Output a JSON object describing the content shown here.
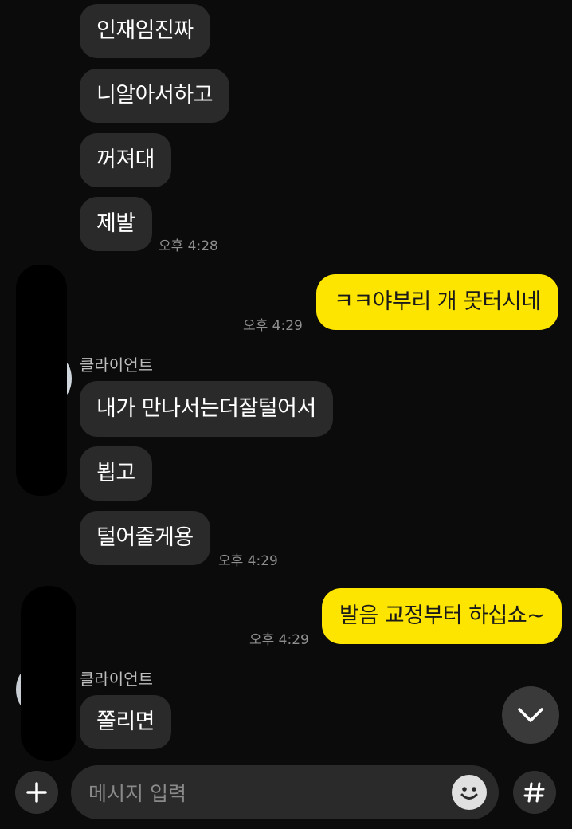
{
  "chat": {
    "messages": [
      {
        "text": "인재임진짜"
      },
      {
        "text": "니알아서하고"
      },
      {
        "text": "꺼져대"
      },
      {
        "text": "제발",
        "time": "오후 4:28"
      },
      {
        "text": "ㅋㅋ야부리 개 못터시네",
        "time": "오후 4:29"
      },
      {
        "sender": "클라이언트",
        "text": "내가 만나서는더잘털어서"
      },
      {
        "text": "뵙고"
      },
      {
        "text": "털어줄게용",
        "time": "오후 4:29"
      },
      {
        "text": "발음 교정부터 하십쇼~",
        "time": "오후 4:29"
      },
      {
        "sender": "클라이언트",
        "text": "쫄리면"
      }
    ]
  },
  "composer": {
    "placeholder": "메시지 입력",
    "plus_icon": "plus-icon",
    "emoji_icon": "emoji-icon",
    "hash_icon": "hash-icon"
  },
  "scroll": {
    "icon": "chevron-down-icon"
  },
  "colors": {
    "background": "#0b0b0b",
    "incoming_bubble": "#2a2a2a",
    "outgoing_bubble": "#fee500",
    "timestamp": "#8f8f8f"
  }
}
